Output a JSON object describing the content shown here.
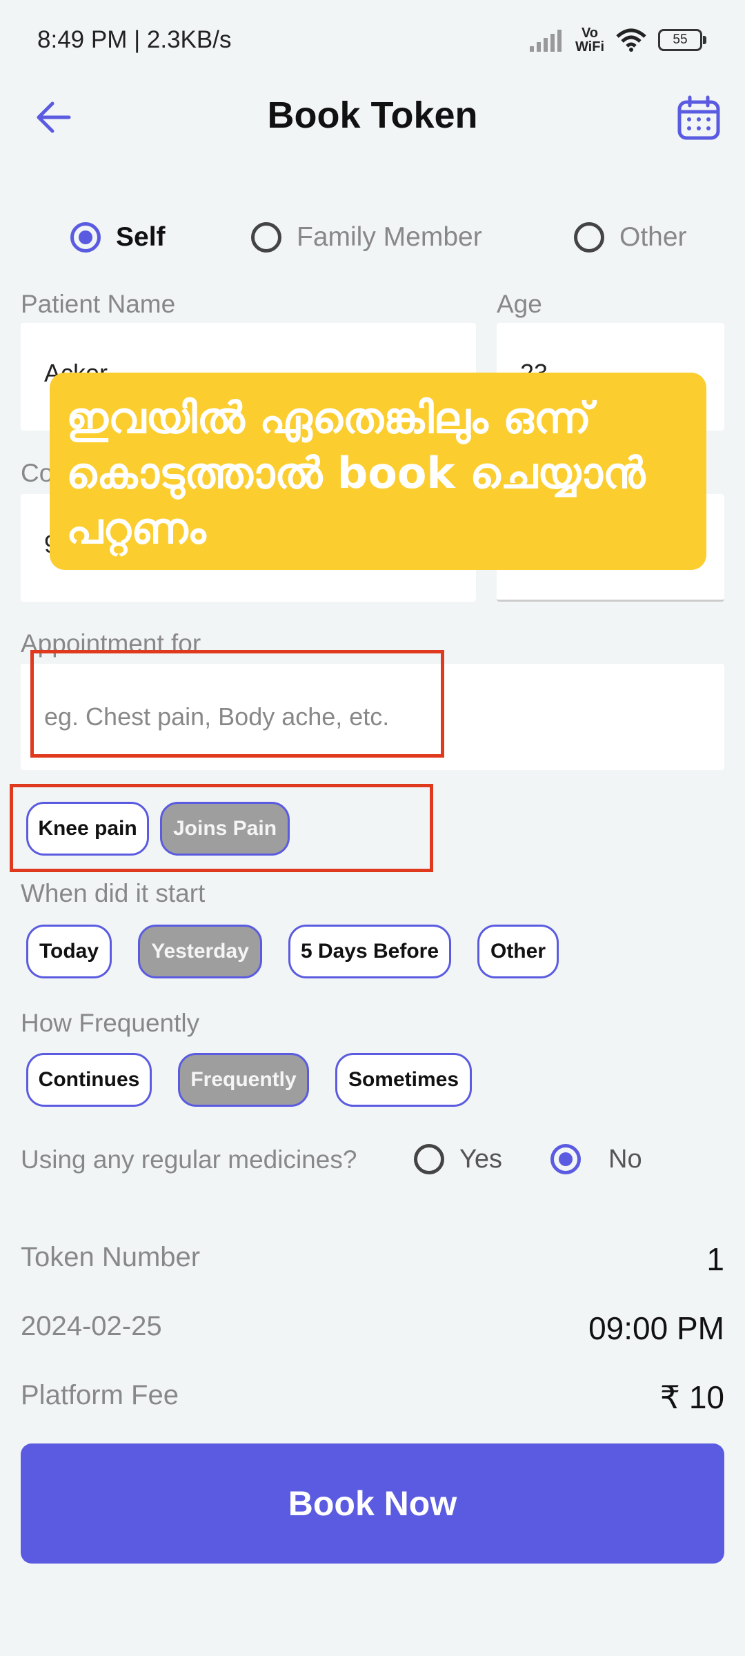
{
  "status_bar": {
    "time": "8:49 PM | 2.3KB/s",
    "vowifi": "Vo\nWiFi",
    "battery": "55"
  },
  "header": {
    "title": "Book Token",
    "back_icon": "arrow-left-icon",
    "calendar_icon": "calendar-icon"
  },
  "patient_type": {
    "options": [
      "Self",
      "Family Member",
      "Other"
    ],
    "selected": "Self"
  },
  "form": {
    "patient_name_label": "Patient Name",
    "patient_name_value": "Acker",
    "age_label": "Age",
    "age_value": "23",
    "contact_label_partial": "Co",
    "contact_value_partial": "9",
    "appointment_label": "Appointment for",
    "appointment_placeholder": "eg. Chest pain, Body ache, etc."
  },
  "symptom_chips": {
    "items": [
      "Knee pain",
      "Joins Pain"
    ],
    "selected": "Joins Pain"
  },
  "start": {
    "label": "When did it start",
    "items": [
      "Today",
      "Yesterday",
      "5 Days Before",
      "Other"
    ],
    "selected": "Yesterday"
  },
  "frequency": {
    "label": "How Frequently",
    "items": [
      "Continues",
      "Frequently",
      "Sometimes"
    ],
    "selected": "Frequently"
  },
  "medicines": {
    "label": "Using any regular medicines?",
    "options": [
      "Yes",
      "No"
    ],
    "selected": "No"
  },
  "summary": {
    "token_label": "Token Number",
    "token_value": "1",
    "date": "2024-02-25",
    "time": "09:00 PM",
    "fee_label": "Platform Fee",
    "fee_value": "₹ 10"
  },
  "book_button": "Book Now",
  "overlay_note": "ഇവയിൽ ഏതെങ്കിലും ഒന്ന് കൊടുത്താൽ book ചെയ്യാൻ പറ്റണം",
  "colors": {
    "accent": "#5a5be0",
    "highlight": "#e03a1e",
    "overlay": "#fbcd2f",
    "chip_selected": "#9e9e9e"
  }
}
